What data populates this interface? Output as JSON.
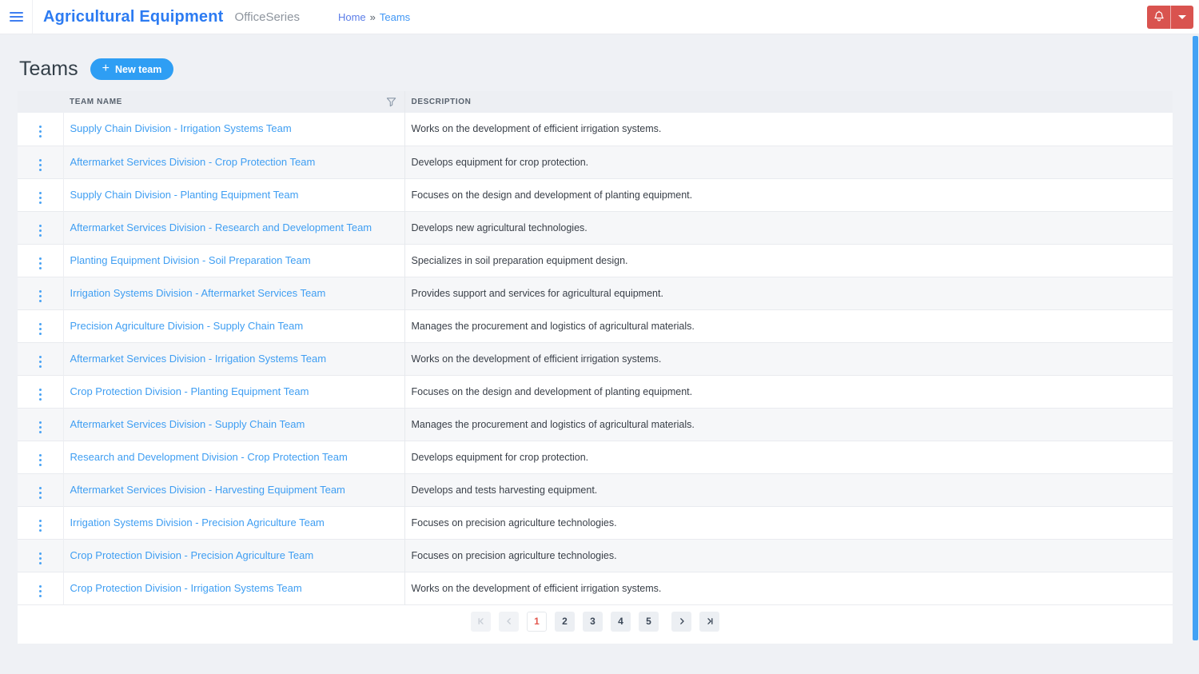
{
  "header": {
    "app_title": "Agricultural Equipment",
    "suite_label": "OfficeSeries",
    "breadcrumb": {
      "home": "Home",
      "separator": "»",
      "current": "Teams"
    }
  },
  "page": {
    "title": "Teams",
    "new_team_button": {
      "plus": "+",
      "label": "New team"
    }
  },
  "icons": {
    "menu": "hamburger-icon",
    "bell": "bell-icon",
    "caret_down": "caret-down-icon",
    "filter": "filter-funnel-icon",
    "row_menu": "kebab-menu-icon",
    "first_page": "chevron-bar-left",
    "prev_page": "chevron-left",
    "next_page": "chevron-right",
    "last_page": "chevron-bar-right"
  },
  "table": {
    "columns": {
      "team_name": "TEAM NAME",
      "description": "DESCRIPTION"
    },
    "rows": [
      {
        "name": "Supply Chain Division - Irrigation Systems Team",
        "description": "Works on the development of efficient irrigation systems."
      },
      {
        "name": "Aftermarket Services Division - Crop Protection Team",
        "description": "Develops equipment for crop protection."
      },
      {
        "name": "Supply Chain Division - Planting Equipment Team",
        "description": "Focuses on the design and development of planting equipment."
      },
      {
        "name": "Aftermarket Services Division - Research and Development Team",
        "description": "Develops new agricultural technologies."
      },
      {
        "name": "Planting Equipment Division - Soil Preparation Team",
        "description": "Specializes in soil preparation equipment design."
      },
      {
        "name": "Irrigation Systems Division - Aftermarket Services Team",
        "description": "Provides support and services for agricultural equipment."
      },
      {
        "name": "Precision Agriculture Division - Supply Chain Team",
        "description": "Manages the procurement and logistics of agricultural materials."
      },
      {
        "name": "Aftermarket Services Division - Irrigation Systems Team",
        "description": "Works on the development of efficient irrigation systems."
      },
      {
        "name": "Crop Protection Division - Planting Equipment Team",
        "description": "Focuses on the design and development of planting equipment."
      },
      {
        "name": "Aftermarket Services Division - Supply Chain Team",
        "description": "Manages the procurement and logistics of agricultural materials."
      },
      {
        "name": "Research and Development Division - Crop Protection Team",
        "description": "Develops equipment for crop protection."
      },
      {
        "name": "Aftermarket Services Division - Harvesting Equipment Team",
        "description": "Develops and tests harvesting equipment."
      },
      {
        "name": "Irrigation Systems Division - Precision Agriculture Team",
        "description": "Focuses on precision agriculture technologies."
      },
      {
        "name": "Crop Protection Division - Precision Agriculture Team",
        "description": "Focuses on precision agriculture technologies."
      },
      {
        "name": "Crop Protection Division - Irrigation Systems Team",
        "description": "Works on the development of efficient irrigation systems."
      }
    ]
  },
  "pagination": {
    "pages": [
      "1",
      "2",
      "3",
      "4",
      "5"
    ],
    "current_page": "1"
  },
  "colors": {
    "title_blue": "#2c7bf2",
    "link_blue": "#3f9ef2",
    "button_blue": "#2e9ef4",
    "danger_red": "#d9534f",
    "active_page_red": "#e2574e",
    "scrollbar_blue": "#42a2f5",
    "page_background": "#eff1f5",
    "table_header_bg": "#edeff3"
  }
}
